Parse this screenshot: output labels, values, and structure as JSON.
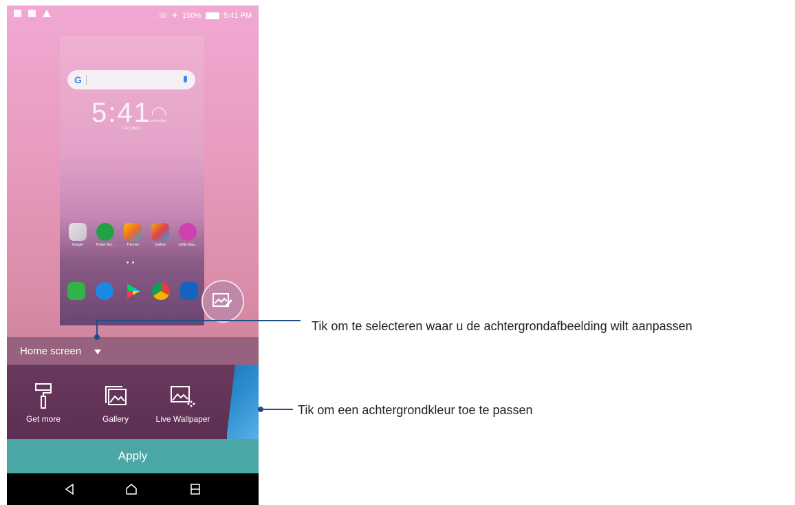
{
  "status_bar": {
    "battery": "100%",
    "time": "5:41 PM"
  },
  "preview": {
    "search_logo": "G",
    "clock_time": "5:41",
    "clock_date": "Tue | Nov 7",
    "weather_text": "No connection",
    "apps": [
      {
        "label": "Google",
        "color": "#6aa84f"
      },
      {
        "label": "Power Ma...",
        "color": "#22a045"
      },
      {
        "label": "Themes",
        "color": "#f06a2a"
      },
      {
        "label": "Gallery",
        "color": "#f4b000"
      },
      {
        "label": "Selfie Mas...",
        "color": "#d040b0"
      }
    ],
    "dock": [
      {
        "name": "phone",
        "color": "#31b24a"
      },
      {
        "name": "messages",
        "color": "#1e88e5"
      },
      {
        "name": "play-store",
        "color": "#ffffff"
      },
      {
        "name": "chrome",
        "color": "#ffffff"
      },
      {
        "name": "camera",
        "color": "#1565c0"
      }
    ]
  },
  "selector": {
    "label": "Home screen"
  },
  "options": [
    {
      "label": "Get more",
      "icon": "paint-roller-icon"
    },
    {
      "label": "Gallery",
      "icon": "gallery-icon"
    },
    {
      "label": "Live Wallpaper",
      "icon": "live-wallpaper-icon"
    }
  ],
  "apply_label": "Apply",
  "callouts": {
    "selector": "Tik om te selecteren waar u de achtergrondafbeelding wilt aanpassen",
    "color": "Tik om een achtergrondkleur toe te passen"
  },
  "colors": {
    "accent_teal": "#4aa7a6",
    "leader_line": "#1a4f8b"
  }
}
